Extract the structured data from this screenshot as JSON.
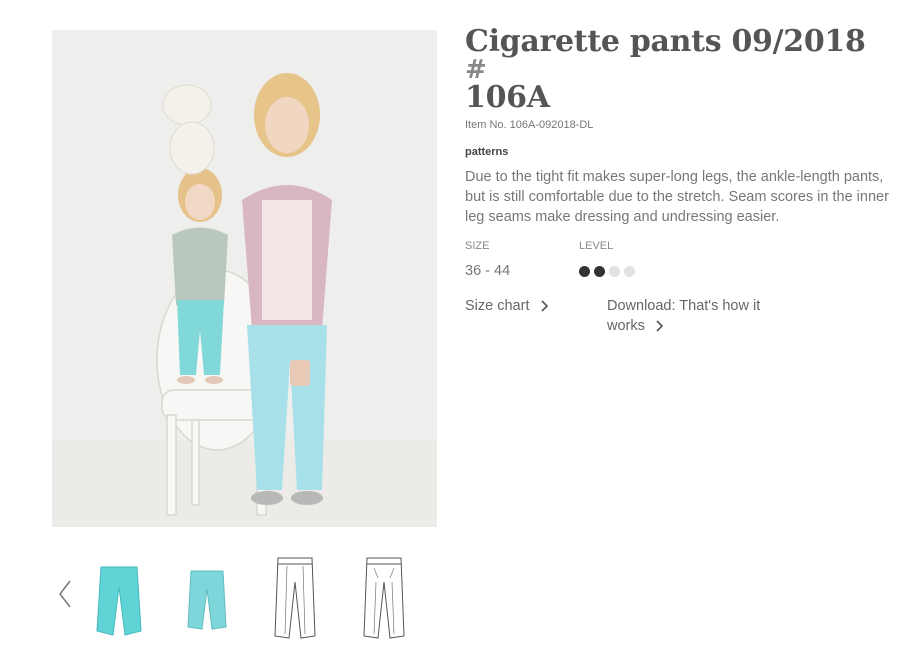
{
  "product": {
    "title": "Cigarette pants 09/2018",
    "title_hash": "#",
    "title_code": "106A",
    "item_number": "Item No. 106A-092018-DL",
    "category": "patterns",
    "description": "Due to the tight fit makes super-long legs, the ankle-length pants, but is still comfortable due to the stretch. Seam scores in the inner leg seams make dressing and undressing easier."
  },
  "specs": {
    "size_label": "SIZE",
    "size_value": "36 - 44",
    "level_label": "LEVEL",
    "level_value": 2,
    "level_max": 4
  },
  "links": {
    "size_chart": "Size chart",
    "download_line1": "Download: That's how it",
    "download_line2": "works"
  },
  "gallery": {
    "thumbnails": [
      {
        "name": "thumb-pants-photo-front",
        "kind": "photo",
        "color": "#5fd3d6"
      },
      {
        "name": "thumb-pants-photo-back",
        "kind": "photo",
        "color": "#7fd6da"
      },
      {
        "name": "thumb-pants-sketch-front",
        "kind": "sketch",
        "color": "#555555"
      },
      {
        "name": "thumb-pants-sketch-back",
        "kind": "sketch",
        "color": "#555555"
      }
    ]
  },
  "colors": {
    "level_filled": "#333333",
    "level_empty": "#e3e3e3",
    "text": "#777777"
  }
}
